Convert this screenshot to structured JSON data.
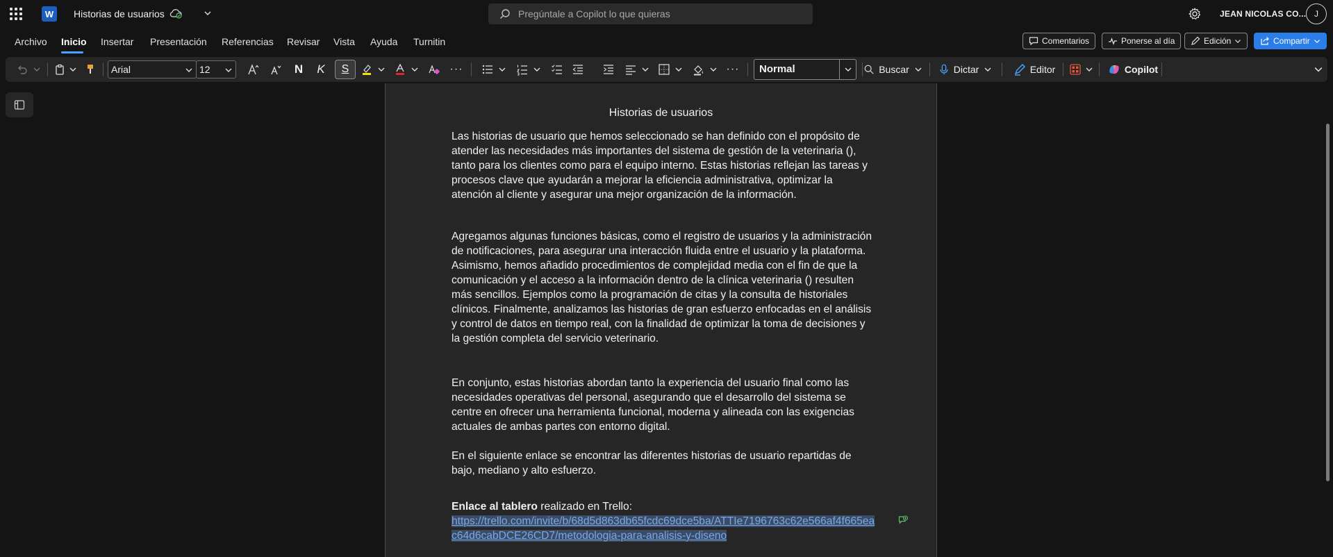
{
  "app": {
    "doc_title": "Historias de usuarios",
    "search_placeholder": "Pregúntale a Copilot lo que quieras",
    "user_name": "JEAN NICOLAS CO...",
    "avatar_initial": "J",
    "logo_letter": "W"
  },
  "menu": {
    "tabs": [
      "Archivo",
      "Inicio",
      "Insertar",
      "Presentación",
      "Referencias",
      "Revisar",
      "Vista",
      "Ayuda",
      "Turnitin"
    ],
    "active_tab": "Inicio",
    "comments_label": "Comentarios",
    "catchup_label": "Ponerse al día",
    "editing_label": "Edición",
    "share_label": "Compartir"
  },
  "ribbon": {
    "font_name": "Arial",
    "font_size": "12",
    "bold_glyph": "N",
    "italic_glyph": "K",
    "strike_glyph": "S",
    "style_name": "Normal",
    "find_label": "Buscar",
    "dictate_label": "Dictar",
    "editor_label": "Editor",
    "copilot_label": "Copilot"
  },
  "document": {
    "heading": "Historias de usuarios",
    "p1": "Las historias de usuario que hemos seleccionado se han definido con el propósito de atender las necesidades más importantes del sistema de gestión de la veterinaria (), tanto para los clientes como para el equipo interno. Estas historias reflejan las tareas y procesos clave que ayudarán a mejorar la eficiencia administrativa, optimizar la atención al cliente y asegurar una mejor organización de la información.",
    "p2": "Agregamos algunas funciones básicas, como el registro de usuarios y la administración de notificaciones, para asegurar una interacción fluida entre el usuario y la plataforma. Asimismo, hemos añadido procedimientos de complejidad media con el fin de que la comunicación y el acceso a la información dentro de la clínica veterinaria () resulten más sencillos. Ejemplos como la programación de citas y la consulta de historiales clínicos. Finalmente, analizamos las historias de gran esfuerzo enfocadas en el análisis y control de datos en tiempo real, con la finalidad de optimizar la toma de decisiones y la gestión completa del servicio veterinario.",
    "p3": "En conjunto, estas historias abordan tanto la experiencia del usuario final como las necesidades operativas del personal, asegurando que el desarrollo del sistema se centre en ofrecer una herramienta funcional, moderna y alineada con las exigencias actuales de ambas partes con entorno digital.",
    "p4": "En el siguiente enlace se encontrar las diferentes historias de usuario repartidas de bajo, mediano y alto esfuerzo.",
    "link_intro_bold": "Enlace al tablero",
    "link_intro_rest": " realizado en Trello:",
    "link_url": "https://trello.com/invite/b/68d5d863db65fcdc69dce5ba/ATTIe7196763c62e566af4f665eac64d6cabDCE26CD7/metodologia-para-analisis-y-diseno"
  },
  "colors": {
    "accent": "#4aa3ff",
    "share_button": "#2b7de9",
    "page": "#262626",
    "link": "#7aa8e6"
  }
}
